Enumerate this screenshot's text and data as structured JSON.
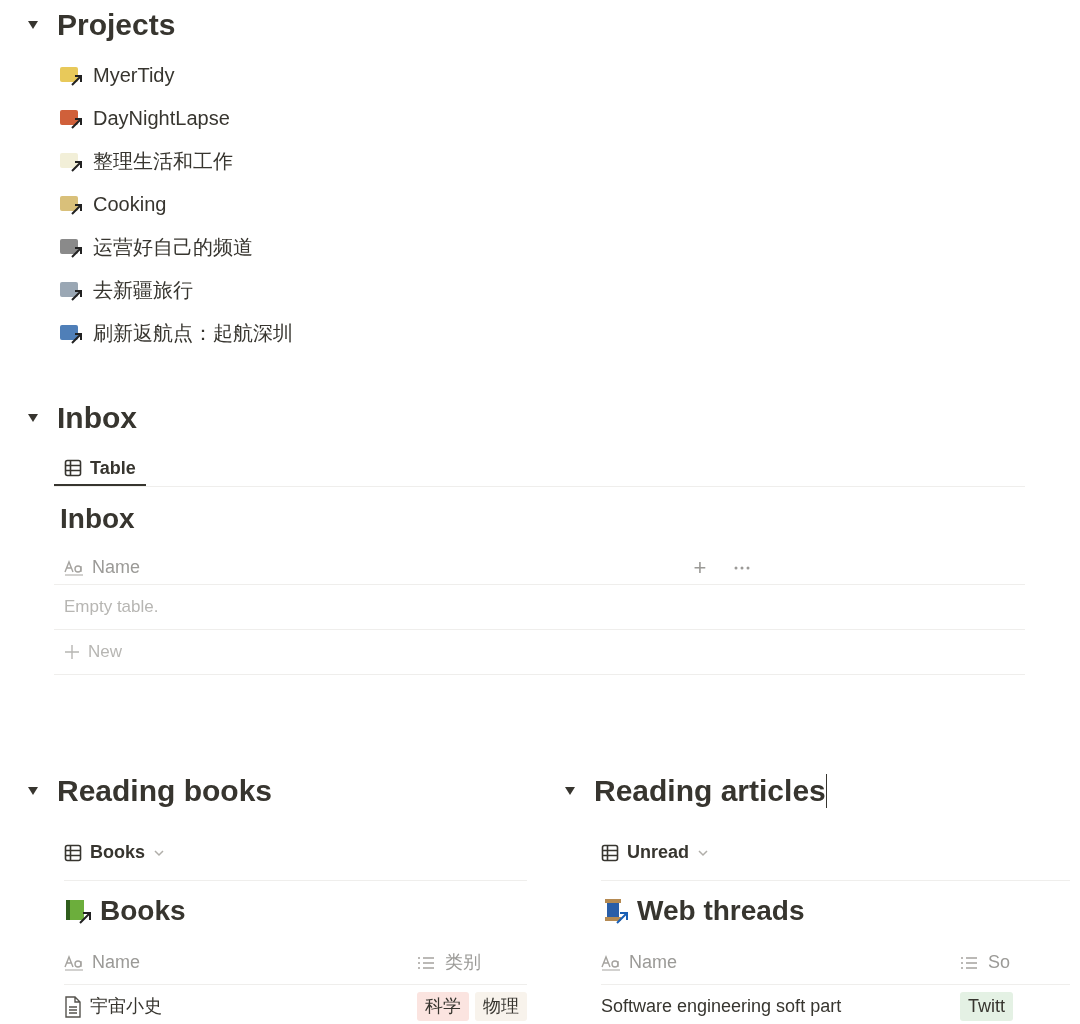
{
  "projects": {
    "title": "Projects",
    "expanded": true,
    "items": [
      {
        "label": "MyerTidy"
      },
      {
        "label": "DayNightLapse"
      },
      {
        "label": "整理生活和工作"
      },
      {
        "label": "Cooking"
      },
      {
        "label": "运营好自己的频道"
      },
      {
        "label": "去新疆旅行"
      },
      {
        "label": "刷新返航点：起航深圳"
      }
    ]
  },
  "inbox": {
    "title": "Inbox",
    "expanded": true,
    "views": [
      {
        "label": "Table",
        "selected": true
      }
    ],
    "table_title": "Inbox",
    "columns": [
      "Name"
    ],
    "add_column_symbol": "+",
    "empty_text": "Empty table.",
    "new_label": "New"
  },
  "reading_books": {
    "title": "Reading books",
    "expanded": true,
    "view": "Books",
    "table_title": "Books",
    "columns": [
      "Name",
      "类别"
    ],
    "rows": [
      {
        "name": "宇宙小史",
        "tags": [
          {
            "label": "科学",
            "color": "#fbe4e0"
          },
          {
            "label": "物理",
            "color": "#f8f3ec"
          }
        ]
      }
    ]
  },
  "reading_articles": {
    "title": "Reading articles",
    "expanded": true,
    "view": "Unread",
    "table_title": "Web threads",
    "columns": [
      "Name",
      "So"
    ],
    "rows": [
      {
        "name": "Software engineering soft part",
        "tags": [
          {
            "label": "Twitt",
            "color": "#e4f1e4"
          }
        ]
      }
    ]
  }
}
